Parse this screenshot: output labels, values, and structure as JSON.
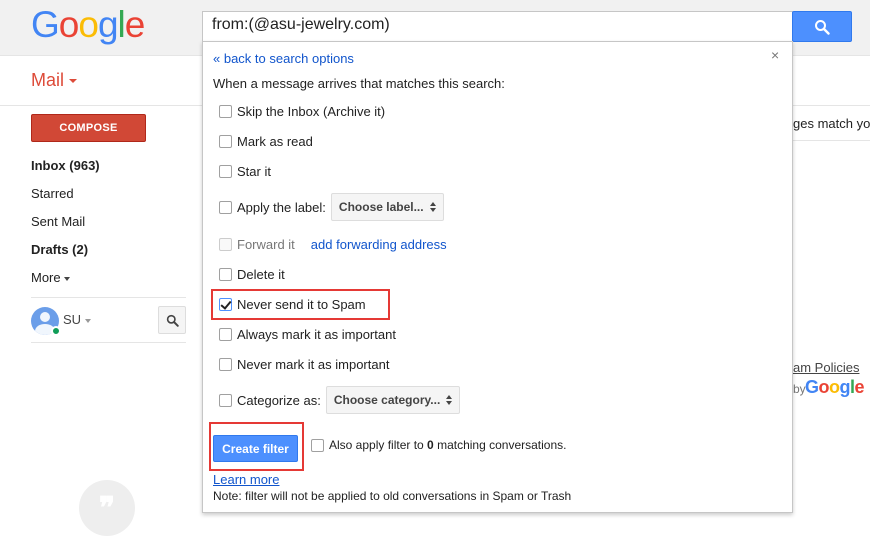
{
  "logo": {
    "letters": [
      "G",
      "o",
      "o",
      "g",
      "l",
      "e"
    ],
    "colors": [
      "#4285f4",
      "#ea4335",
      "#fbbc05",
      "#4285f4",
      "#34a853",
      "#ea4335"
    ]
  },
  "search": {
    "value": "from:(@asu-jewelry.com)",
    "button_icon": "search-icon"
  },
  "mail": {
    "label": "Mail"
  },
  "compose": {
    "label": "COMPOSE"
  },
  "nav": {
    "items": [
      {
        "label": "Inbox (963)",
        "bold": true
      },
      {
        "label": "Starred",
        "bold": false
      },
      {
        "label": "Sent Mail",
        "bold": false
      },
      {
        "label": "Drafts (2)",
        "bold": true
      },
      {
        "label": "More",
        "bold": false
      }
    ]
  },
  "user": {
    "initials": "SU"
  },
  "background": {
    "partial_right_text": "ges match yo",
    "policies_text": "am Policies",
    "by_text": "by",
    "google_word": "Google"
  },
  "filter_panel": {
    "back_link": "« back to search options",
    "close": "×",
    "intro": "When a message arrives that matches this search:",
    "options": {
      "skip_inbox": {
        "label": "Skip the Inbox (Archive it)",
        "checked": false
      },
      "mark_read": {
        "label": "Mark as read",
        "checked": false
      },
      "star": {
        "label": "Star it",
        "checked": false
      },
      "apply_label": {
        "label": "Apply the label:",
        "checked": false,
        "select_value": "Choose label..."
      },
      "forward": {
        "label": "Forward it",
        "checked": false,
        "disabled": true,
        "link": "add forwarding address"
      },
      "delete": {
        "label": "Delete it",
        "checked": false
      },
      "never_spam": {
        "label": "Never send it to Spam",
        "checked": true
      },
      "always_important": {
        "label": "Always mark it as important",
        "checked": false
      },
      "never_important": {
        "label": "Never mark it as important",
        "checked": false
      },
      "categorize": {
        "label": "Categorize as:",
        "checked": false,
        "select_value": "Choose category..."
      }
    },
    "create_button": "Create filter",
    "also_apply": {
      "prefix": "Also apply filter to ",
      "count": "0",
      "suffix": " matching conversations."
    },
    "learn_more": "Learn more",
    "note": "Note: filter will not be applied to old conversations in Spam or Trash"
  },
  "colors": {
    "accent_blue": "#4d90fe",
    "compose_red": "#d14836",
    "highlight_red": "#e53935",
    "link_blue": "#1155cc"
  }
}
